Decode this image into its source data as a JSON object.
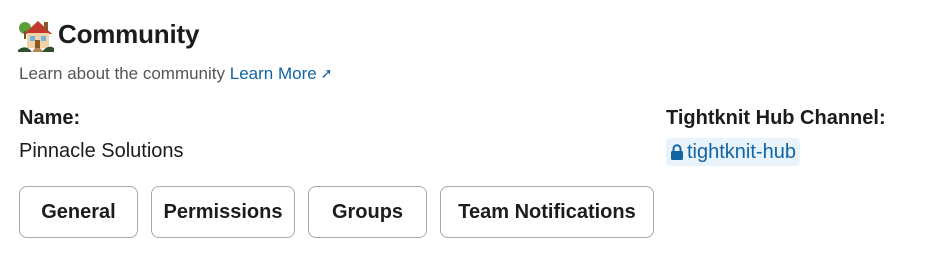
{
  "header": {
    "icon": "house-with-garden-icon",
    "title": "Community"
  },
  "description": {
    "text": "Learn about the community",
    "link_label": "Learn More",
    "link_icon": "external-link-arrow-icon"
  },
  "fields": {
    "name_label": "Name:",
    "name_value": "Pinnacle Solutions",
    "hub_label": "Tightknit Hub Channel:",
    "hub_channel": "tightknit-hub",
    "hub_channel_icon": "lock-icon"
  },
  "tabs": [
    {
      "label": "General"
    },
    {
      "label": "Permissions"
    },
    {
      "label": "Groups"
    },
    {
      "label": "Team Notifications"
    }
  ],
  "colors": {
    "link": "#1264a3",
    "channel_bg": "#e8f3fb",
    "text": "#1d1c1d",
    "muted": "#555555",
    "button_border": "#a8a8a8"
  }
}
